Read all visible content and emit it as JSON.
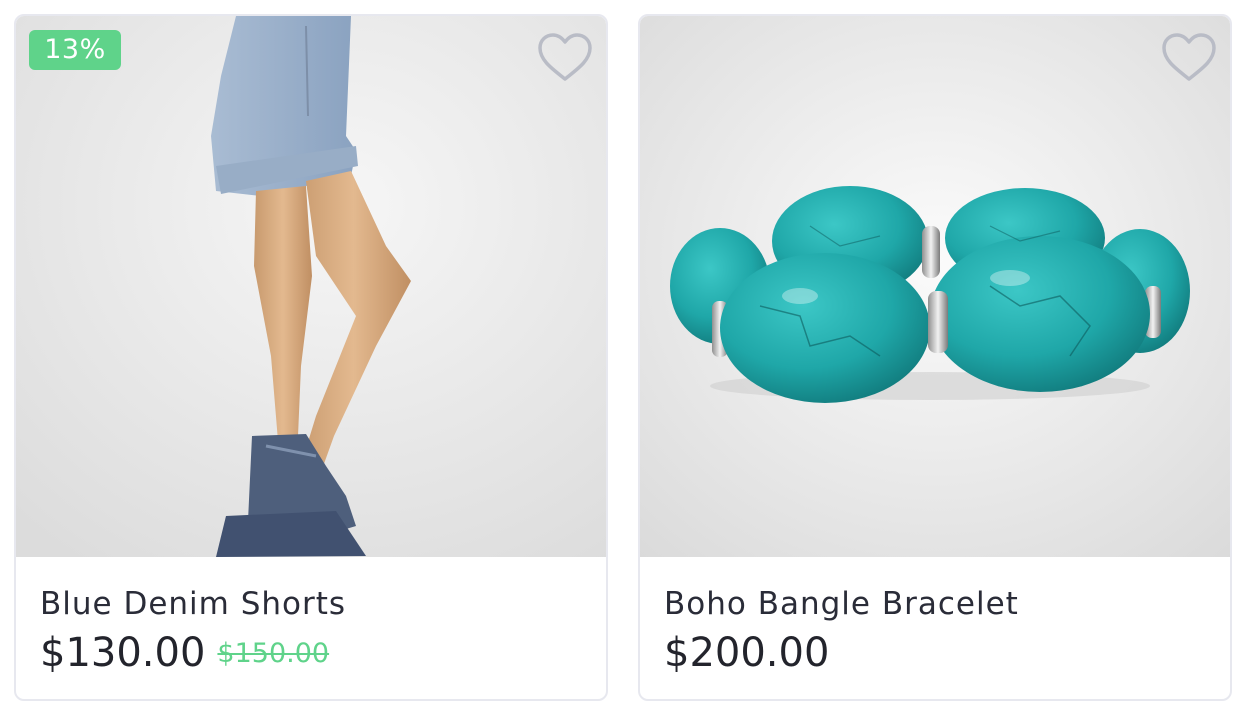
{
  "products": [
    {
      "name": "Blue Denim Shorts",
      "price": "$130.00",
      "old_price": "$150.00",
      "discount_badge": "13%",
      "favorite_icon": "heart-outline-icon",
      "image": "denim-shorts-photo"
    },
    {
      "name": "Boho Bangle Bracelet",
      "price": "$200.00",
      "favorite_icon": "heart-outline-icon",
      "image": "turquoise-bracelet-photo"
    }
  ],
  "colors": {
    "accent_green": "#5fd38a",
    "card_border": "#e7e8ef",
    "text_dark": "#23242c",
    "heart_outline": "#b9bcc6"
  }
}
